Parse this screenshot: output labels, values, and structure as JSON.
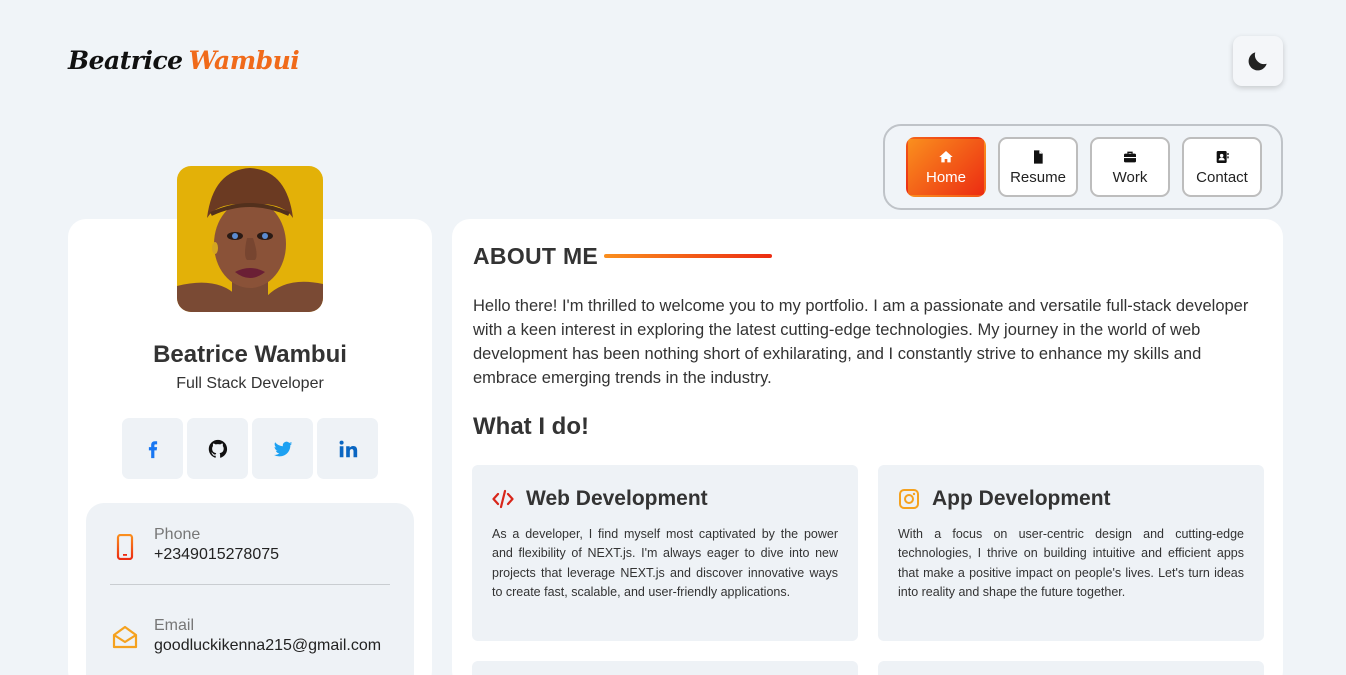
{
  "header": {
    "logo_first": "Beatrice",
    "logo_last": "Wambui",
    "theme_toggle_icon": "moon-icon"
  },
  "nav": {
    "items": [
      {
        "label": "Home",
        "icon": "home-icon",
        "active": true
      },
      {
        "label": "Resume",
        "icon": "file-icon",
        "active": false
      },
      {
        "label": "Work",
        "icon": "briefcase-icon",
        "active": false
      },
      {
        "label": "Contact",
        "icon": "contact-card-icon",
        "active": false
      }
    ]
  },
  "profile": {
    "name": "Beatrice Wambui",
    "role": "Full Stack Developer",
    "socials": [
      "facebook-icon",
      "github-icon",
      "twitter-icon",
      "linkedin-icon"
    ],
    "contacts": [
      {
        "label": "Phone",
        "value": "+2349015278075",
        "icon": "phone-icon"
      },
      {
        "label": "Email",
        "value": "goodluckikenna215@gmail.com",
        "icon": "envelope-icon"
      }
    ]
  },
  "about": {
    "title": "ABOUT ME",
    "text": "Hello there! I'm thrilled to welcome you to my portfolio. I am a passionate and versatile full-stack developer with a keen interest in exploring the latest cutting-edge technologies. My journey in the world of web development has been nothing short of exhilarating, and I constantly strive to enhance my skills and embrace emerging trends in the industry.",
    "what_title": "What I do!",
    "services": [
      {
        "title": "Web Development",
        "icon": "code-icon",
        "text": "As a developer, I find myself most captivated by the power and flexibility of NEXT.js. I'm always eager to dive into new projects that leverage NEXT.js and discover innovative ways to create fast, scalable, and user-friendly applications."
      },
      {
        "title": "App Development",
        "icon": "app-icon",
        "text": "With a focus on user-centric design and cutting-edge technologies, I thrive on building intuitive and efficient apps that make a positive impact on people's lives. Let's turn ideas into reality and shape the future together."
      }
    ]
  },
  "colors": {
    "accent_start": "#fa8f1e",
    "accent_end": "#ec2c12",
    "background": "#f0f4f8"
  }
}
